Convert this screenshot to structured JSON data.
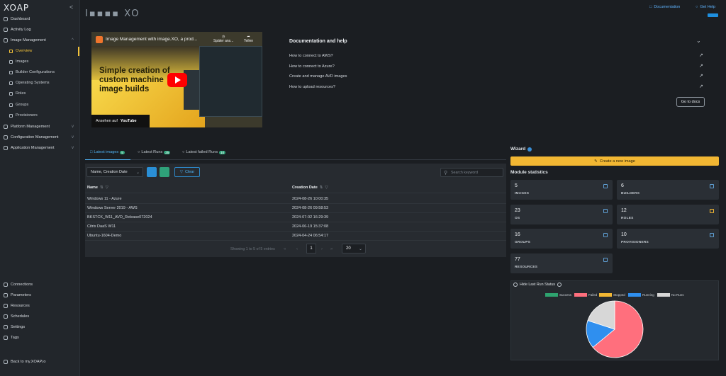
{
  "sidebar": {
    "logo": "XOAP",
    "collapse": "<",
    "items": [
      {
        "label": "Dashboard"
      },
      {
        "label": "Activity Log"
      },
      {
        "label": "Image Management"
      },
      {
        "label": "Overview"
      },
      {
        "label": "Images"
      },
      {
        "label": "Builder Configurations"
      },
      {
        "label": "Operating Systems"
      },
      {
        "label": "Roles"
      },
      {
        "label": "Groups"
      },
      {
        "label": "Provisioners"
      },
      {
        "label": "Platform Management"
      },
      {
        "label": "Configuration Management"
      },
      {
        "label": "Application Management"
      }
    ],
    "bottom": [
      {
        "label": "Connections"
      },
      {
        "label": "Parameters"
      },
      {
        "label": "Resources"
      },
      {
        "label": "Schedules"
      },
      {
        "label": "Settings"
      },
      {
        "label": "Tags"
      }
    ],
    "back": "Back to my.XOAP.io",
    "active_color": "#f2c23a"
  },
  "header": {
    "brand": "I▪▪▪▪ XO",
    "documentation": "Documentation",
    "get_help": "Get Help"
  },
  "video": {
    "title": "Image Management with image.XO, a prod...",
    "later": "Später ans...",
    "share": "Teilen",
    "headline": "Simple creation of custom machine image builds",
    "watch_on": "Ansehen auf",
    "youtube": "YouTube"
  },
  "docs": {
    "title": "Documentation and help",
    "links": [
      {
        "label": "How to connect to AWS?"
      },
      {
        "label": "How to connect to Azure?"
      },
      {
        "label": "Create and manage AVD images"
      },
      {
        "label": "How to upload resources?"
      }
    ],
    "go_to_docs": "Go to docs"
  },
  "tabs": [
    {
      "label": "Latest images",
      "badge": "5"
    },
    {
      "label": "Latest Runs",
      "badge": "25"
    },
    {
      "label": "Latest failed Runs",
      "badge": "10"
    }
  ],
  "table": {
    "sort_value": "Name, Creation Date",
    "clear_label": "Clear",
    "search_placeholder": "Search keyword",
    "columns": [
      "Name",
      "Creation Date"
    ],
    "rows": [
      [
        "Windows 11 - Azure",
        "2024-08-26 10:00:35"
      ],
      [
        "Windows Server 2019 - AWS",
        "2024-08-26 09:58:53"
      ],
      [
        "BKSTCK_W11_AVD_Release072024",
        "2024-07-02 16:29:39"
      ],
      [
        "Citrix DaaS W11",
        "2024-06-19 15:37:08"
      ],
      [
        "Ubuntu-1604-Demo",
        "2024-04-24 06:54:17"
      ]
    ],
    "pager_info": "Showing 1 to 5 of 5 entries",
    "page": "1",
    "per_page": "20"
  },
  "wizard": {
    "title": "Wizard",
    "create_label": "Create a new image",
    "accent": "#f2b733"
  },
  "module_statistics": {
    "title": "Module statistics",
    "cards": [
      {
        "value": "5",
        "label": "IMAGES"
      },
      {
        "value": "6",
        "label": "BUILDERS"
      },
      {
        "value": "23",
        "label": "OS"
      },
      {
        "value": "12",
        "label": "ROLES"
      },
      {
        "value": "16",
        "label": "GROUPS"
      },
      {
        "value": "10",
        "label": "PROVISIONERS"
      },
      {
        "value": "77",
        "label": "RESOURCES"
      }
    ]
  },
  "run_status": {
    "toggle_label": "Hide Last Run Status",
    "legend": [
      {
        "label": "Success",
        "color": "#2ea36f"
      },
      {
        "label": "Failed",
        "color": "#ff6f7d"
      },
      {
        "label": "Stopped",
        "color": "#f2b733"
      },
      {
        "label": "Running",
        "color": "#2f8fef"
      },
      {
        "label": "No Runs",
        "color": "#d7d7d7"
      }
    ]
  },
  "chart_data": {
    "type": "pie",
    "categories": [
      "Success",
      "Failed",
      "Stopped",
      "Running",
      "No Runs"
    ],
    "values": [
      0,
      16,
      0,
      4,
      5
    ],
    "colors": [
      "#2ea36f",
      "#ff6f7d",
      "#f2b733",
      "#2f8fef",
      "#d7d7d7"
    ]
  }
}
